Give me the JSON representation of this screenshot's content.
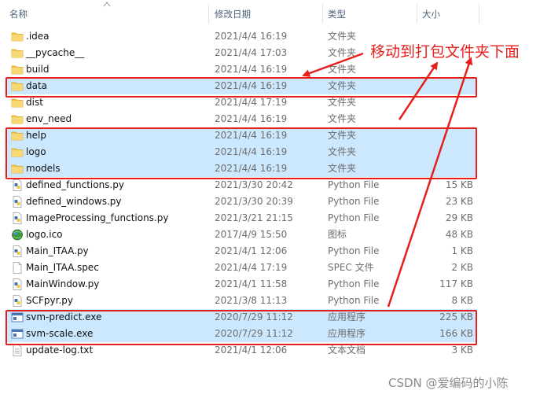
{
  "columns": {
    "name": "名称",
    "date": "修改日期",
    "type": "类型",
    "size": "大小"
  },
  "files": [
    {
      "name": ".idea",
      "date": "2021/4/4 16:19",
      "type": "文件夹",
      "size": "",
      "icon": "folder-icon",
      "selected": false
    },
    {
      "name": "__pycache__",
      "date": "2021/4/4 17:03",
      "type": "文件夹",
      "size": "",
      "icon": "folder-icon",
      "selected": false
    },
    {
      "name": "build",
      "date": "2021/4/4 16:19",
      "type": "文件夹",
      "size": "",
      "icon": "folder-icon",
      "selected": false
    },
    {
      "name": "data",
      "date": "2021/4/4 16:19",
      "type": "文件夹",
      "size": "",
      "icon": "folder-icon",
      "selected": true
    },
    {
      "name": "dist",
      "date": "2021/4/4 17:19",
      "type": "文件夹",
      "size": "",
      "icon": "folder-icon",
      "selected": false
    },
    {
      "name": "env_need",
      "date": "2021/4/4 16:19",
      "type": "文件夹",
      "size": "",
      "icon": "folder-icon",
      "selected": false
    },
    {
      "name": "help",
      "date": "2021/4/4 16:19",
      "type": "文件夹",
      "size": "",
      "icon": "folder-icon",
      "selected": true
    },
    {
      "name": "logo",
      "date": "2021/4/4 16:19",
      "type": "文件夹",
      "size": "",
      "icon": "folder-icon",
      "selected": true
    },
    {
      "name": "models",
      "date": "2021/4/4 16:19",
      "type": "文件夹",
      "size": "",
      "icon": "folder-icon",
      "selected": true
    },
    {
      "name": "defined_functions.py",
      "date": "2021/3/30 20:42",
      "type": "Python File",
      "size": "15 KB",
      "icon": "python-file-icon",
      "selected": false
    },
    {
      "name": "defined_windows.py",
      "date": "2021/3/30 20:39",
      "type": "Python File",
      "size": "23 KB",
      "icon": "python-file-icon",
      "selected": false
    },
    {
      "name": "ImageProcessing_functions.py",
      "date": "2021/3/21 21:15",
      "type": "Python File",
      "size": "29 KB",
      "icon": "python-file-icon",
      "selected": false
    },
    {
      "name": "logo.ico",
      "date": "2017/4/9 15:50",
      "type": "图标",
      "size": "48 KB",
      "icon": "globe-icon",
      "selected": false
    },
    {
      "name": "Main_ITAA.py",
      "date": "2021/4/1 12:06",
      "type": "Python File",
      "size": "1 KB",
      "icon": "python-file-icon",
      "selected": false
    },
    {
      "name": "Main_ITAA.spec",
      "date": "2021/4/4 17:19",
      "type": "SPEC 文件",
      "size": "2 KB",
      "icon": "blank-file-icon",
      "selected": false
    },
    {
      "name": "MainWindow.py",
      "date": "2021/4/1 11:58",
      "type": "Python File",
      "size": "117 KB",
      "icon": "python-file-icon",
      "selected": false
    },
    {
      "name": "SCFpyr.py",
      "date": "2021/3/8 11:13",
      "type": "Python File",
      "size": "8 KB",
      "icon": "python-file-icon",
      "selected": false
    },
    {
      "name": "svm-predict.exe",
      "date": "2020/7/29 11:12",
      "type": "应用程序",
      "size": "225 KB",
      "icon": "exe-icon",
      "selected": true
    },
    {
      "name": "svm-scale.exe",
      "date": "2020/7/29 11:12",
      "type": "应用程序",
      "size": "166 KB",
      "icon": "exe-icon",
      "selected": true
    },
    {
      "name": "update-log.txt",
      "date": "2021/4/1 12:06",
      "type": "文本文档",
      "size": "3 KB",
      "icon": "text-file-icon",
      "selected": false
    }
  ],
  "annotation": {
    "text": "移动到打包文件夹下面",
    "color": "#e5201c"
  },
  "watermark": "CSDN @爱编码的小陈",
  "colors": {
    "selection": "#cce8ff",
    "folder": "#f5c542",
    "highlight": "#e5201c"
  }
}
